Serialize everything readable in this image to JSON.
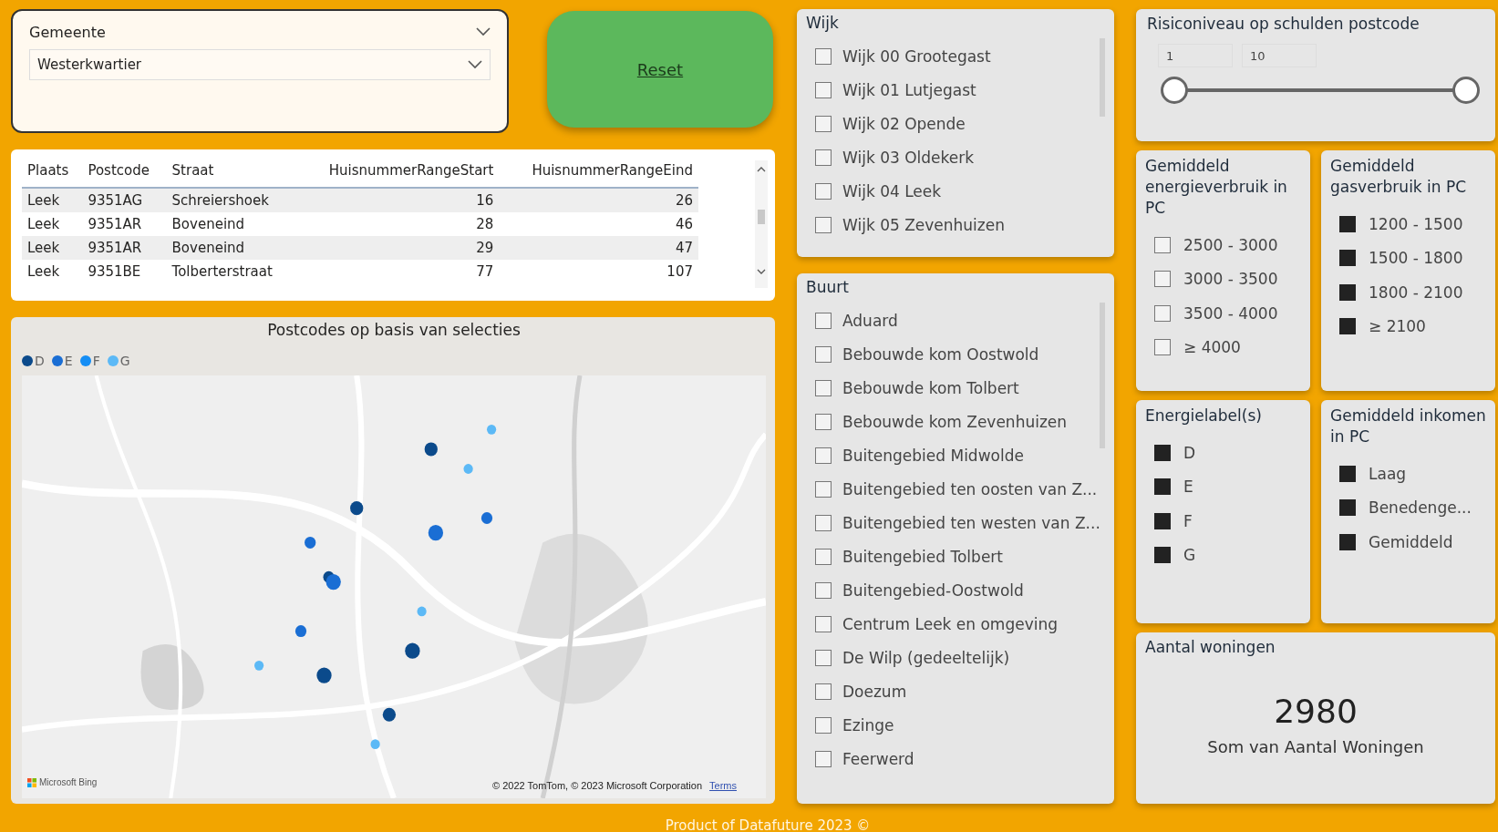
{
  "gemeente": {
    "title": "Gemeente",
    "value": "Westerkwartier"
  },
  "reset": {
    "label": "Reset"
  },
  "table": {
    "columns": [
      "Plaats",
      "Postcode",
      "Straat",
      "HuisnummerRangeStart",
      "HuisnummerRangeEind"
    ],
    "rows": [
      [
        "Leek",
        "9351AG",
        "Schreiershoek",
        "16",
        "26"
      ],
      [
        "Leek",
        "9351AR",
        "Boveneind",
        "28",
        "46"
      ],
      [
        "Leek",
        "9351AR",
        "Boveneind",
        "29",
        "47"
      ],
      [
        "Leek",
        "9351BE",
        "Tolberterstraat",
        "77",
        "107"
      ]
    ]
  },
  "map": {
    "title": "Postcodes op basis van selecties",
    "legend": [
      {
        "label": "D",
        "color": "#0b4a8b"
      },
      {
        "label": "E",
        "color": "#1a6ed4"
      },
      {
        "label": "F",
        "color": "#158ef5"
      },
      {
        "label": "G",
        "color": "#5cb9f6"
      }
    ],
    "logo": "Microsoft Bing",
    "attribution": "© 2022 TomTom, © 2023 Microsoft Corporation",
    "terms": "Terms"
  },
  "wijk": {
    "title": "Wijk",
    "items": [
      {
        "label": "Wijk 00 Grootegast",
        "checked": false
      },
      {
        "label": "Wijk 01 Lutjegast",
        "checked": false
      },
      {
        "label": "Wijk 02 Opende",
        "checked": false
      },
      {
        "label": "Wijk 03 Oldekerk",
        "checked": false
      },
      {
        "label": "Wijk 04 Leek",
        "checked": false
      },
      {
        "label": "Wijk 05 Zevenhuizen",
        "checked": false
      }
    ]
  },
  "buurt": {
    "title": "Buurt",
    "items": [
      {
        "label": "Aduard",
        "checked": false
      },
      {
        "label": "Bebouwde kom Oostwold",
        "checked": false
      },
      {
        "label": "Bebouwde kom Tolbert",
        "checked": false
      },
      {
        "label": "Bebouwde kom Zevenhuizen",
        "checked": false
      },
      {
        "label": "Buitengebied Midwolde",
        "checked": false
      },
      {
        "label": "Buitengebied ten oosten van Z...",
        "checked": false
      },
      {
        "label": "Buitengebied ten westen van Z...",
        "checked": false
      },
      {
        "label": "Buitengebied Tolbert",
        "checked": false
      },
      {
        "label": "Buitengebied-Oostwold",
        "checked": false
      },
      {
        "label": "Centrum Leek en omgeving",
        "checked": false
      },
      {
        "label": "De Wilp (gedeeltelijk)",
        "checked": false
      },
      {
        "label": "Doezum",
        "checked": false
      },
      {
        "label": "Ezinge",
        "checked": false
      },
      {
        "label": "Feerwerd",
        "checked": false
      }
    ]
  },
  "risico": {
    "title": "Risiconiveau op schulden postcode",
    "min": "1",
    "max": "10",
    "level": 1
  },
  "energie": {
    "title": "Gemiddeld energieverbruik in PC",
    "items": [
      {
        "label": "2500 - 3000",
        "checked": false
      },
      {
        "label": "3000 - 3500",
        "checked": false
      },
      {
        "label": "3500 - 4000",
        "checked": false
      },
      {
        "label": "≥ 4000",
        "checked": false
      }
    ]
  },
  "gas": {
    "title": "Gemiddeld gasverbruik in PC",
    "items": [
      {
        "label": "1200 - 1500",
        "checked": true
      },
      {
        "label": "1500 - 1800",
        "checked": true
      },
      {
        "label": "1800 - 2100",
        "checked": true
      },
      {
        "label": "≥ 2100",
        "checked": true
      }
    ]
  },
  "energielabel": {
    "title": "Energielabel(s)",
    "items": [
      {
        "label": "D",
        "checked": true
      },
      {
        "label": "E",
        "checked": true
      },
      {
        "label": "F",
        "checked": true
      },
      {
        "label": "G",
        "checked": true
      }
    ]
  },
  "inkomen": {
    "title": "Gemiddeld inkomen in PC",
    "items": [
      {
        "label": "Laag",
        "checked": true
      },
      {
        "label": "Benedenge...",
        "checked": true
      },
      {
        "label": "Gemiddeld",
        "checked": true
      }
    ]
  },
  "aantal": {
    "title": "Aantal woningen",
    "value": "2980",
    "caption": "Som van Aantal Woningen"
  },
  "footer": "Product of Datafuture 2023 ©"
}
